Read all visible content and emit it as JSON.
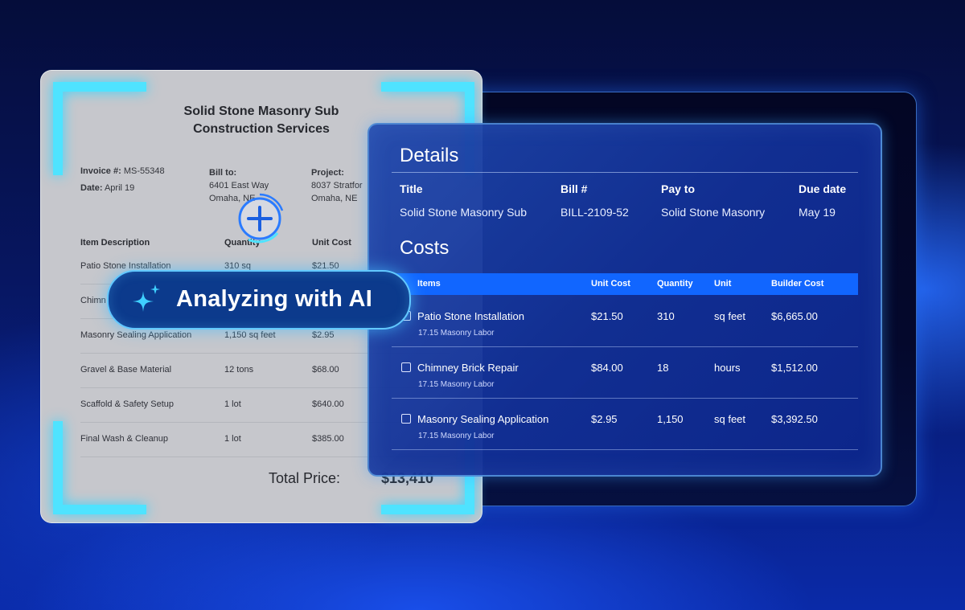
{
  "invoice": {
    "title_line1": "Solid Stone Masonry Sub",
    "title_line2": "Construction Services",
    "invoice_label": "Invoice #:",
    "invoice_number": "MS-55348",
    "date_label": "Date:",
    "date_value": "April 19",
    "bill_to_label": "Bill to:",
    "bill_to_line1": "6401 East Way",
    "bill_to_line2": "Omaha, NE",
    "project_label": "Project:",
    "project_line1": "8037 Stratfor",
    "project_line2": "Omaha, NE",
    "headers": {
      "description": "Item Description",
      "quantity": "Quantity",
      "unit_cost": "Unit Cost"
    },
    "rows": [
      {
        "description": "Patio Stone Installation",
        "quantity": "310 sq",
        "unit_cost": "$21.50"
      },
      {
        "description": "Chimn",
        "quantity": "",
        "unit_cost": ""
      },
      {
        "description": "Masonry Sealing Application",
        "quantity": "1,150 sq feet",
        "unit_cost": "$2.95"
      },
      {
        "description": "Gravel & Base Material",
        "quantity": "12 tons",
        "unit_cost": "$68.00"
      },
      {
        "description": "Scaffold & Safety Setup",
        "quantity": "1 lot",
        "unit_cost": "$640.00"
      },
      {
        "description": "Final Wash & Cleanup",
        "quantity": "1 lot",
        "unit_cost": "$385.00"
      }
    ],
    "total_label": "Total Price:",
    "total_value": "$13,410"
  },
  "analyzing": {
    "label": "Analyzing with AI"
  },
  "details": {
    "heading": "Details",
    "title_label": "Title",
    "title_value": "Solid Stone Masonry Sub",
    "bill_label": "Bill #",
    "bill_value": "BILL-2109-52",
    "payto_label": "Pay to",
    "payto_value": "Solid Stone Masonry",
    "due_label": "Due date",
    "due_value": "May 19"
  },
  "costs": {
    "heading": "Costs",
    "headers": {
      "items": "Items",
      "unit_cost": "Unit Cost",
      "quantity": "Quantity",
      "unit": "Unit",
      "builder_cost": "Builder Cost"
    },
    "rows": [
      {
        "name": "Patio Stone Installation",
        "sub": "17.15 Masonry Labor",
        "unit_cost": "$21.50",
        "quantity": "310",
        "unit": "sq feet",
        "builder_cost": "$6,665.00"
      },
      {
        "name": "Chimney Brick Repair",
        "sub": "17.15 Masonry Labor",
        "unit_cost": "$84.00",
        "quantity": "18",
        "unit": "hours",
        "builder_cost": "$1,512.00"
      },
      {
        "name": "Masonry Sealing Application",
        "sub": "17.15 Masonry Labor",
        "unit_cost": "$2.95",
        "quantity": "1,150",
        "unit": "sq feet",
        "builder_cost": "$3,392.50"
      }
    ]
  },
  "colors": {
    "accent": "#1166ff",
    "scanner": "#4fe3ff",
    "pill": "#0c3a8c"
  }
}
